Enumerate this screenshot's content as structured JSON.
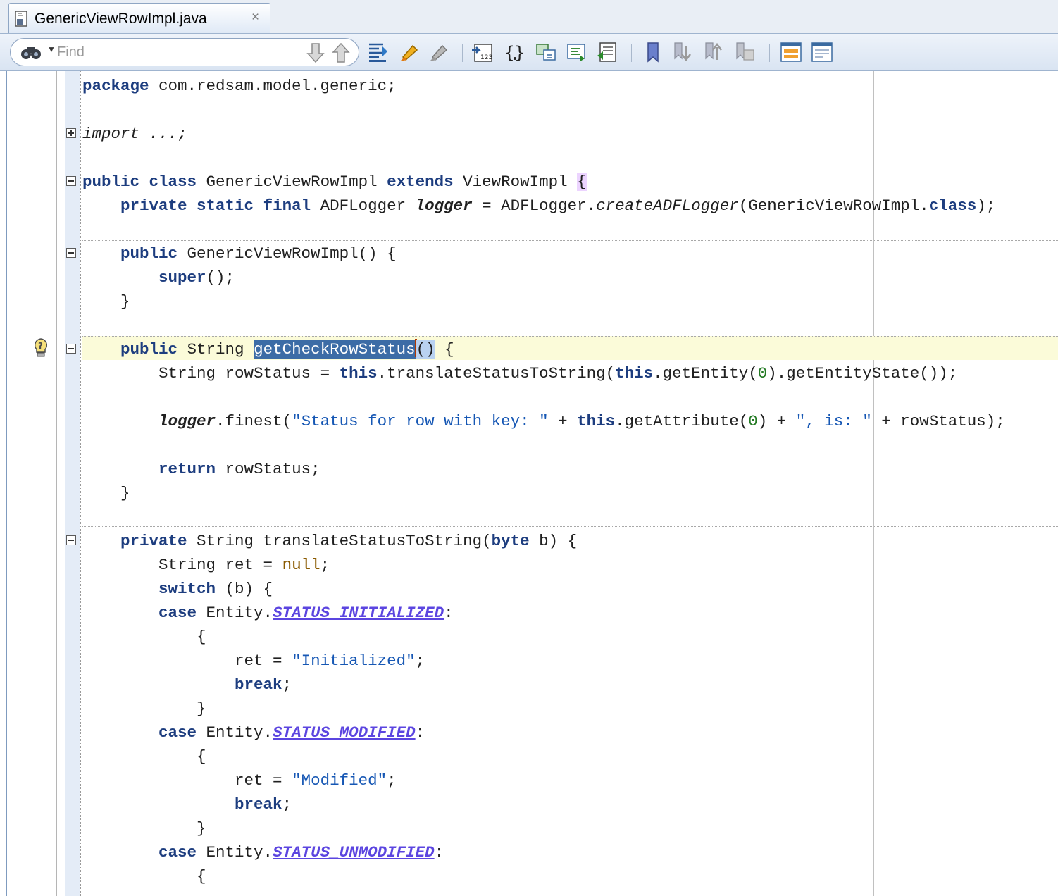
{
  "tab": {
    "title": "GenericViewRowImpl.java",
    "close": "×"
  },
  "toolbar": {
    "find_placeholder": "Find",
    "icons": [
      "binoculars-icon",
      "find-next-icon",
      "find-previous-icon",
      "highlight-occurrences-icon",
      "highlight-icon",
      "clear-highlight-icon",
      "goto-line-icon",
      "brace-match-icon",
      "previous-change-icon",
      "next-change-icon",
      "goto-last-edit-icon",
      "bookmark-icon",
      "next-bookmark-icon",
      "previous-bookmark-icon",
      "clear-bookmarks-icon",
      "split-editor-icon",
      "properties-icon"
    ]
  },
  "code": {
    "package": {
      "kw": "package",
      "rest": " com.redsam.model.generic;"
    },
    "import": {
      "text": "import ...;"
    },
    "class_decl": {
      "kw1": "public",
      "kw2": "class",
      "name": " GenericViewRowImpl ",
      "kw3": "extends",
      "super": " ViewRowImpl ",
      "brace": "{"
    },
    "logger_decl": {
      "kw1": "private",
      "kw2": "static",
      "kw3": "final",
      "type": " ADFLogger ",
      "var": "logger",
      "eq": " = ADFLogger.",
      "method": "createADFLogger",
      "arg": "(GenericViewRowImpl.",
      "kw4": "class",
      "end": ");"
    },
    "ctor_decl": {
      "kw": "public",
      "rest": " GenericViewRowImpl() {"
    },
    "super_call": {
      "kw": "super",
      "rest": "();"
    },
    "close_brace": "}",
    "getter_decl": {
      "kw": "public",
      "type": " String ",
      "name": "getCheckRowStatus",
      "parens": "()",
      "rest": " {"
    },
    "rowstatus_line": {
      "type": "String rowStatus = ",
      "kw1": "this",
      "mid1": ".translateStatusToString(",
      "kw2": "this",
      "mid2": ".getEntity(",
      "num": "0",
      "end": ").getEntityState());"
    },
    "logger_line": {
      "var": "logger",
      "mid1": ".finest(",
      "str1": "\"Status for row with key: \"",
      "mid2": " + ",
      "kw": "this",
      "mid3": ".getAttribute(",
      "num": "0",
      "mid4": ") + ",
      "str2": "\", is: \"",
      "end": " + rowStatus);"
    },
    "return_line": {
      "kw": "return",
      "rest": " rowStatus;"
    },
    "translate_decl": {
      "kw1": "private",
      "type": " String translateStatusToString(",
      "kw2": "byte",
      "rest": " b) {"
    },
    "ret_decl": {
      "type": "String ret = ",
      "nul": "null",
      "end": ";"
    },
    "switch_line": {
      "kw": "switch",
      "rest": " (b) {"
    },
    "case1": {
      "kw": "case",
      "mid": " Entity.",
      "const": "STATUS_INITIALIZED",
      "end": ":"
    },
    "open_brace": "{",
    "ret_init": {
      "pre": "ret = ",
      "str": "\"Initialized\"",
      "end": ";"
    },
    "break_line": {
      "kw": "break",
      "end": ";"
    },
    "case2": {
      "kw": "case",
      "mid": " Entity.",
      "const": "STATUS_MODIFIED",
      "end": ":"
    },
    "ret_mod": {
      "pre": "ret = ",
      "str": "\"Modified\"",
      "end": ";"
    },
    "case3": {
      "kw": "case",
      "mid": " Entity.",
      "const": "STATUS_UNMODIFIED",
      "end": ":"
    }
  }
}
